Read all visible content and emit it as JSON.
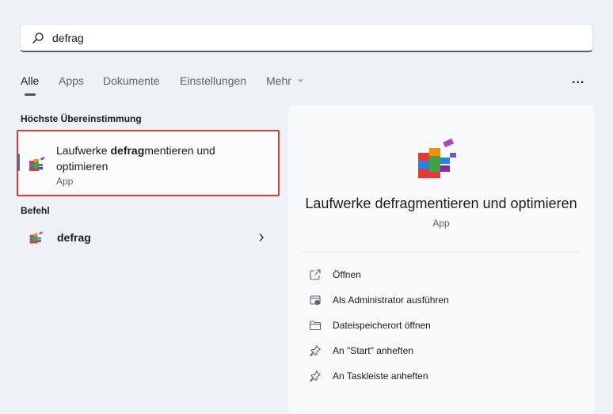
{
  "search": {
    "query": "defrag"
  },
  "tabs": [
    {
      "label": "Alle",
      "active": true
    },
    {
      "label": "Apps"
    },
    {
      "label": "Dokumente"
    },
    {
      "label": "Einstellungen"
    },
    {
      "label": "Mehr"
    }
  ],
  "more_options_label": "...",
  "best_match": {
    "header": "Höchste Übereinstimmung",
    "title_prefix": "Laufwerke ",
    "title_match": "defrag",
    "title_suffix": "mentieren und optimieren",
    "subtitle": "App",
    "icon": "defrag-app-icon"
  },
  "commands": {
    "header": "Befehl",
    "item_label": "defrag",
    "icon": "defrag-app-icon"
  },
  "details": {
    "title": "Laufwerke defragmentieren und optimieren",
    "subtitle": "App",
    "actions": [
      {
        "label": "Öffnen",
        "icon": "open-external-icon"
      },
      {
        "label": "Als Administrator ausführen",
        "icon": "shield-admin-icon"
      },
      {
        "label": "Dateispeicherort öffnen",
        "icon": "folder-icon"
      },
      {
        "label": "An \"Start\" anheften",
        "icon": "pin-icon"
      },
      {
        "label": "An Taskleiste anheften",
        "icon": "pin-icon"
      }
    ]
  },
  "colors": {
    "selection_border": "#e53935",
    "background": "#eef1f6",
    "pane": "#f8f9fb"
  }
}
